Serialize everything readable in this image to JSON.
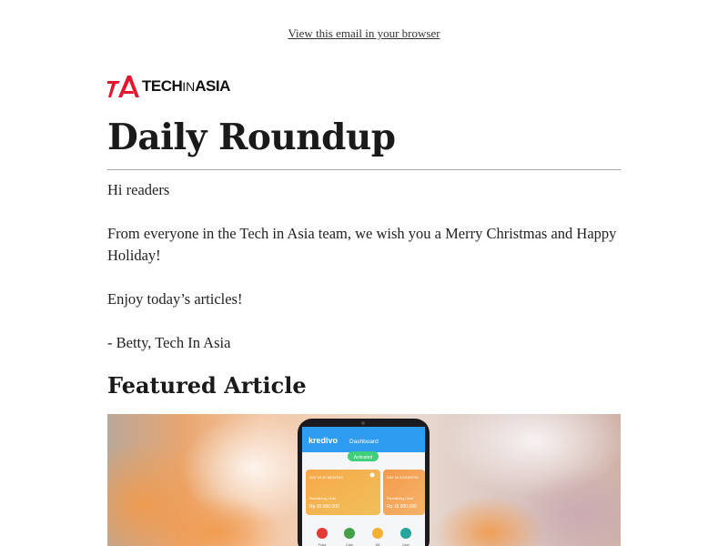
{
  "header": {
    "view_in_browser": "View this email in your browser"
  },
  "logo": {
    "brand_tech": "TECH",
    "brand_in": "IN",
    "brand_asia": "ASIA",
    "icon": "techinasia-logo-icon",
    "accent_color": "#e3172f"
  },
  "title": "Daily Roundup",
  "body": {
    "greeting": "Hi readers",
    "message": "From everyone in the Tech in Asia team, we wish you a Merry Christmas and Happy Holiday!",
    "enjoy": "Enjoy today’s articles!",
    "signoff": "- Betty, Tech In Asia"
  },
  "featured": {
    "section_title": "Featured Article",
    "image": {
      "app_brand": "kredivo",
      "screen_title": "Dashboard",
      "status_pill": "Activated",
      "card1_label": "DAY IN 30 MONTHS",
      "card1_text": "Remaining Limit",
      "card1_amount": "Rp 30.000.000",
      "card2_label": "DAY IN 3 MONTHS",
      "card2_text": "Remaining Limit",
      "card2_amount": "Rp 18.900.000",
      "nav_items": [
        "Pulsa",
        "Data",
        "Bill",
        "Cash"
      ]
    }
  }
}
